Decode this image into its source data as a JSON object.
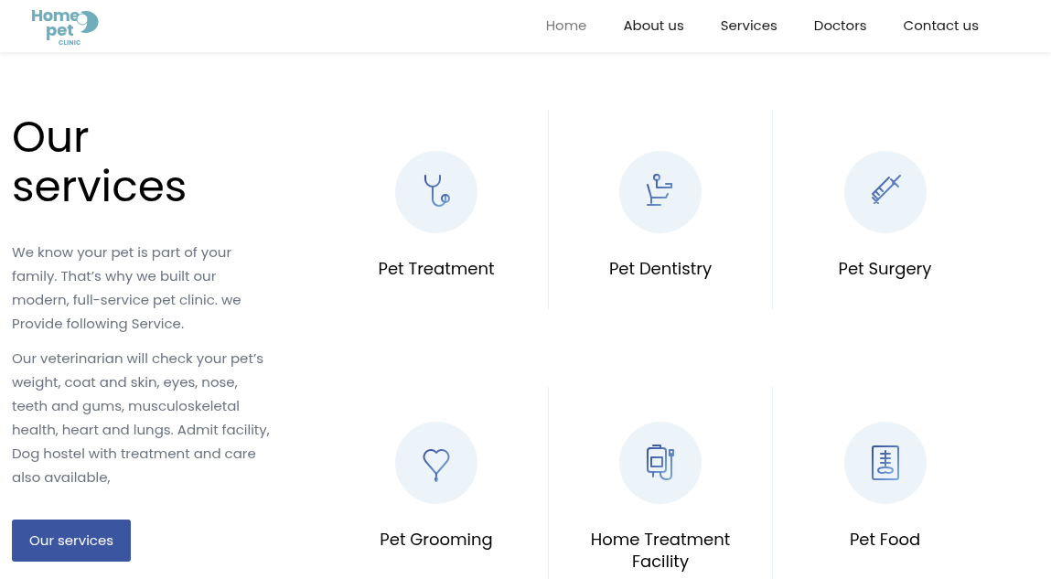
{
  "logo": {
    "line_1": "Home",
    "line_2": "pet",
    "tagline": "CLINIC"
  },
  "nav": [
    {
      "label": "Home",
      "selected": true
    },
    {
      "label": "About us",
      "selected": false
    },
    {
      "label": "Services",
      "selected": false
    },
    {
      "label": "Doctors",
      "selected": false
    },
    {
      "label": "Contact us",
      "selected": false
    }
  ],
  "intro": {
    "title": "Our services",
    "paragraphs": [
      "We know your pet is part of your family.  That’s why we built our modern, full-service pet clinic. we Provide following Service.",
      "Our veterinarian will check your pet’s weight, coat and skin, eyes, nose, teeth and gums, musculoskeletal health, heart and lungs. Admit facility, Dog hostel with treatment and care also available,"
    ],
    "button": "Our services"
  },
  "services": [
    {
      "kind": "stethoscope",
      "title": "Pet Treatment"
    },
    {
      "kind": "chair",
      "title": "Pet Dentistry"
    },
    {
      "kind": "syringe",
      "title": "Pet Surgery"
    },
    {
      "kind": "heart",
      "title": "Pet Grooming"
    },
    {
      "kind": "drip",
      "title": "Home Treatment Facility"
    },
    {
      "kind": "xray",
      "title": "Pet Food"
    }
  ]
}
